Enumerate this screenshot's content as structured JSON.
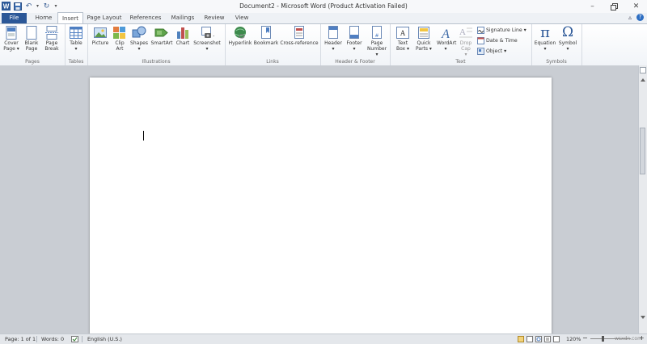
{
  "window": {
    "title": "Document2 - Microsoft Word (Product Activation Failed)",
    "min_glyph": "–",
    "max_glyph": "▫",
    "close_glyph": "✕",
    "app_icon_text": "W"
  },
  "qat": {
    "undo_glyph": "↶",
    "redo_glyph": "↻",
    "dropdown_glyph": "▾"
  },
  "tabs": [
    {
      "label": "File"
    },
    {
      "label": "Home"
    },
    {
      "label": "Insert"
    },
    {
      "label": "Page Layout"
    },
    {
      "label": "References"
    },
    {
      "label": "Mailings"
    },
    {
      "label": "Review"
    },
    {
      "label": "View"
    }
  ],
  "tab_right": {
    "minimize_ribbon": "▵",
    "help": "?"
  },
  "ribbon": {
    "pages": {
      "label": "Pages",
      "cover_page": "Cover Page ▾",
      "blank_page": "Blank Page",
      "page_break": "Page Break"
    },
    "tables": {
      "label": "Tables",
      "table": "Table ▾"
    },
    "illustrations": {
      "label": "Illustrations",
      "picture": "Picture",
      "clip_art": "Clip Art",
      "shapes": "Shapes ▾",
      "smartart": "SmartArt",
      "chart": "Chart",
      "screenshot": "Screenshot ▾"
    },
    "links": {
      "label": "Links",
      "hyperlink": "Hyperlink",
      "bookmark": "Bookmark",
      "cross_reference": "Cross-reference"
    },
    "header_footer": {
      "label": "Header & Footer",
      "header": "Header ▾",
      "footer": "Footer ▾",
      "page_number": "Page Number ▾"
    },
    "text": {
      "label": "Text",
      "text_box": "Text Box ▾",
      "quick_parts": "Quick Parts ▾",
      "wordart": "WordArt ▾",
      "drop_cap": "Drop Cap ▾",
      "signature_line": "Signature Line ▾",
      "date_time": "Date & Time",
      "object": "Object ▾"
    },
    "symbols": {
      "label": "Symbols",
      "equation": "Equation ▾",
      "symbol": "Symbol ▾",
      "equation_glyph": "π",
      "symbol_glyph": "Ω"
    }
  },
  "status": {
    "page": "Page: 1 of 1",
    "words": "Words: 0",
    "language": "English (U.S.)",
    "zoom": "120%",
    "zoom_minus": "−",
    "zoom_plus": "+",
    "watermark": "wsxdn.com"
  }
}
